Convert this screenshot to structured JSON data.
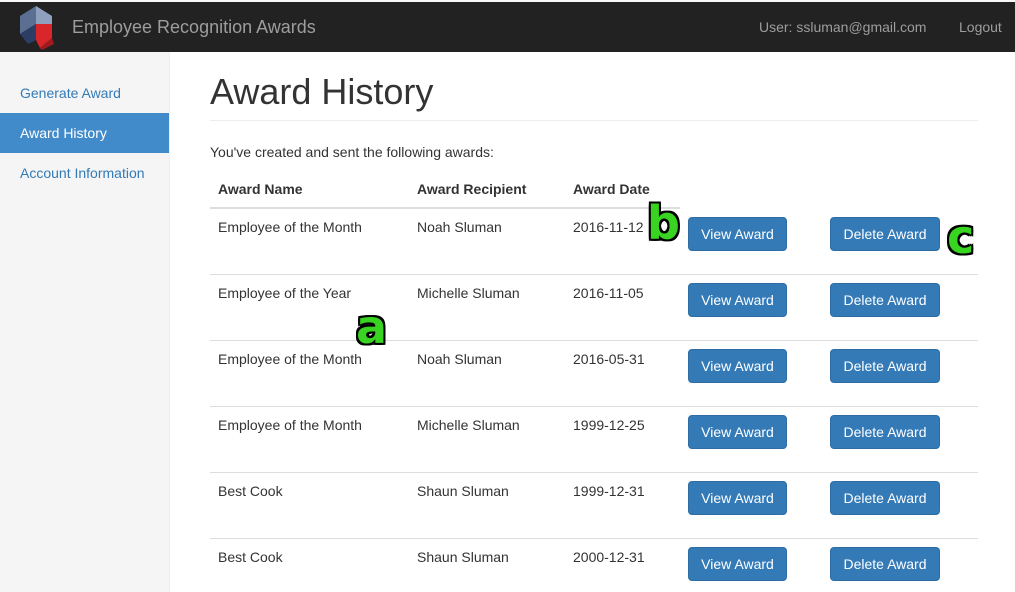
{
  "header": {
    "brand": "Employee Recognition Awards",
    "user": "User: ssluman@gmail.com",
    "logout": "Logout"
  },
  "sidebar": {
    "items": [
      {
        "label": "Generate Award",
        "active": false
      },
      {
        "label": "Award History",
        "active": true
      },
      {
        "label": "Account Information",
        "active": false
      }
    ]
  },
  "main": {
    "title": "Award History",
    "intro": "You've created and sent the following awards:",
    "columns": [
      "Award Name",
      "Award Recipient",
      "Award Date"
    ],
    "rows": [
      {
        "name": "Employee of the Month",
        "recipient": "Noah Sluman",
        "date": "2016-11-12"
      },
      {
        "name": "Employee of the Year",
        "recipient": "Michelle Sluman",
        "date": "2016-11-05"
      },
      {
        "name": "Employee of the Month",
        "recipient": "Noah Sluman",
        "date": "2016-05-31"
      },
      {
        "name": "Employee of the Month",
        "recipient": "Michelle Sluman",
        "date": "1999-12-25"
      },
      {
        "name": "Best Cook",
        "recipient": "Shaun Sluman",
        "date": "1999-12-31"
      },
      {
        "name": "Best Cook",
        "recipient": "Shaun Sluman",
        "date": "2000-12-31"
      }
    ],
    "view_label": "View Award",
    "delete_label": "Delete Award"
  },
  "annotations": {
    "a": "a",
    "b": "b",
    "c": "c"
  },
  "colors": {
    "primary": "#337ab7",
    "navbar": "#222222",
    "active_nav": "#428bca",
    "marker": "#39d321"
  }
}
